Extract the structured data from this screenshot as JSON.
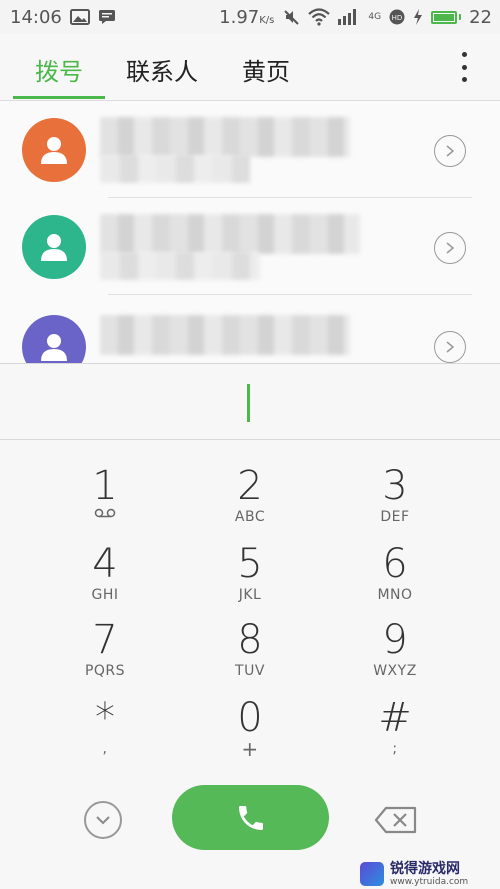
{
  "status_bar": {
    "time": "14:06",
    "speed": "1.97",
    "speed_unit": "K/s",
    "battery_level": "22",
    "network": "4G"
  },
  "tabs": [
    {
      "label": "拨号",
      "active": true
    },
    {
      "label": "联系人",
      "active": false
    },
    {
      "label": "黄页",
      "active": false
    }
  ],
  "recent_calls": [
    {
      "avatar_color": "#e8703a"
    },
    {
      "avatar_color": "#2db58c"
    },
    {
      "avatar_color": "#6a64c8"
    }
  ],
  "keypad": [
    {
      "digit": "1",
      "letters": "",
      "sub_icon": "voicemail-icon"
    },
    {
      "digit": "2",
      "letters": "ABC"
    },
    {
      "digit": "3",
      "letters": "DEF"
    },
    {
      "digit": "4",
      "letters": "GHI"
    },
    {
      "digit": "5",
      "letters": "JKL"
    },
    {
      "digit": "6",
      "letters": "MNO"
    },
    {
      "digit": "7",
      "letters": "PQRS"
    },
    {
      "digit": "8",
      "letters": "TUV"
    },
    {
      "digit": "9",
      "letters": "WXYZ"
    },
    {
      "digit": "*",
      "letters": ","
    },
    {
      "digit": "0",
      "letters": "+"
    },
    {
      "digit": "#",
      "letters": ";"
    }
  ],
  "watermark": {
    "text": "锐得游戏网",
    "url": "www.ytruida.com"
  },
  "colors": {
    "accent": "#4cb84c",
    "call_button": "#55b957"
  }
}
